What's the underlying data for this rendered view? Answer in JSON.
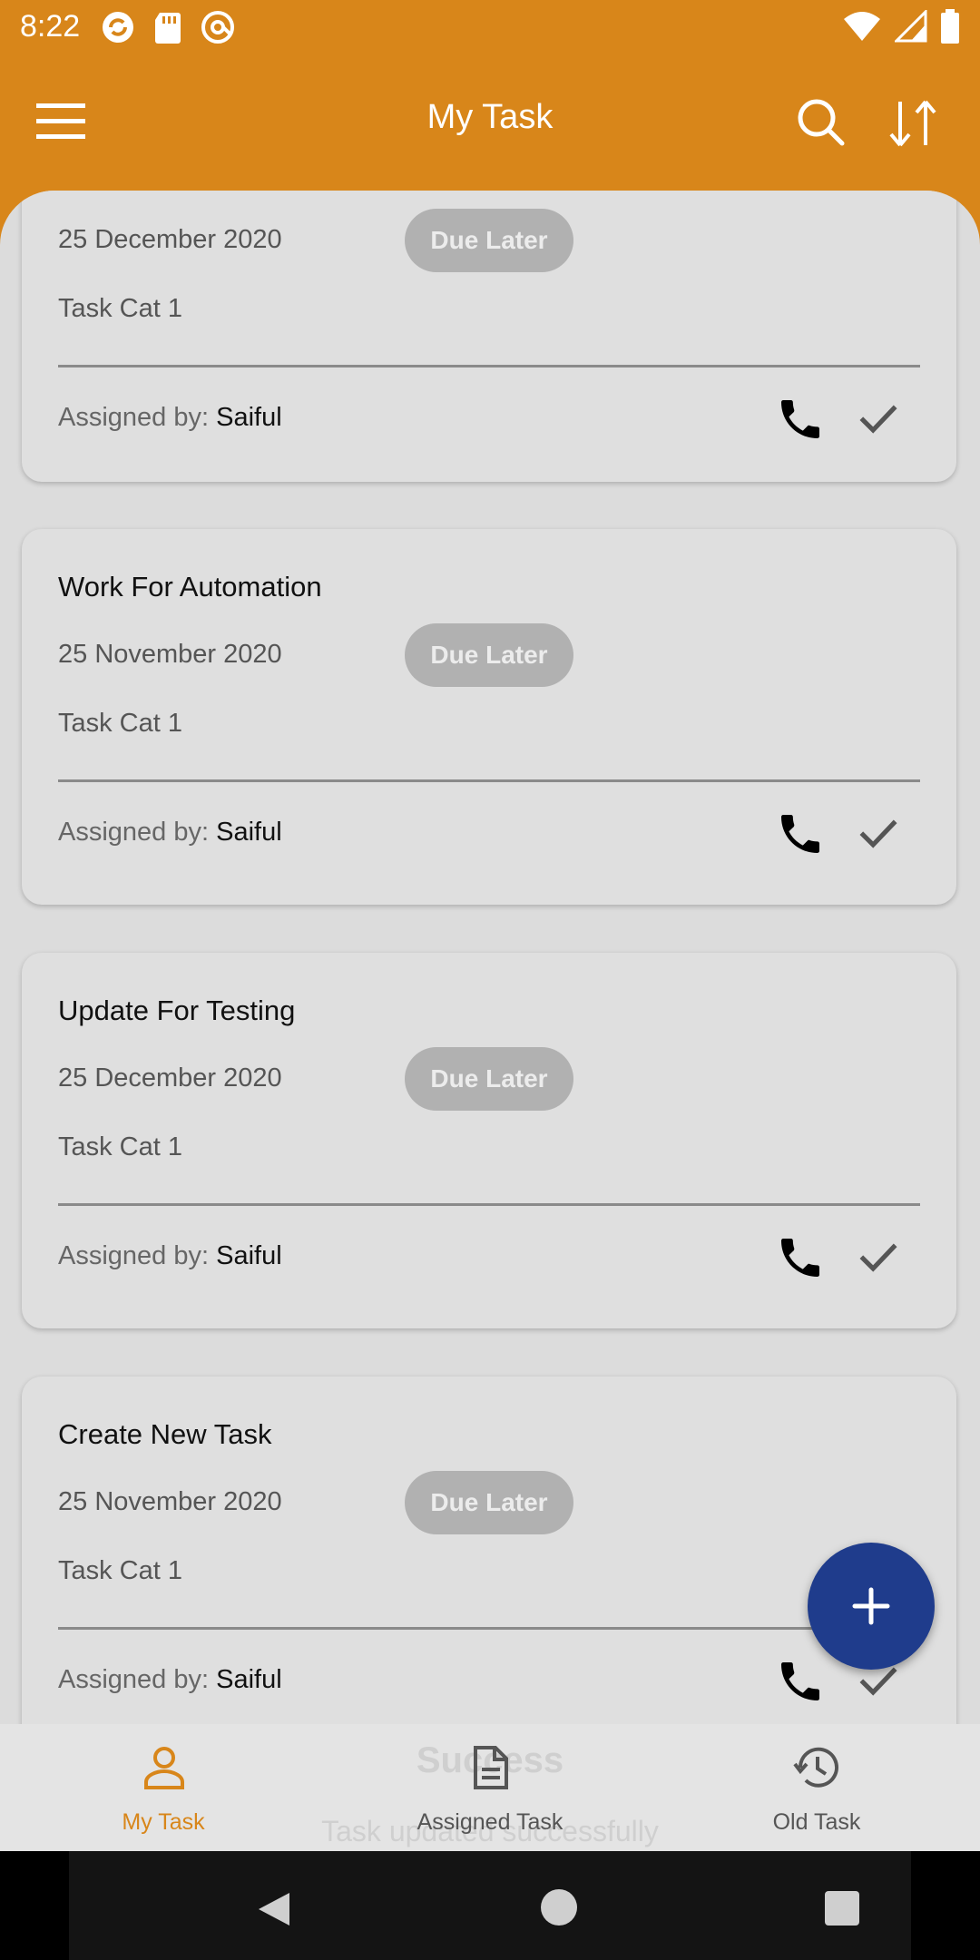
{
  "status_bar": {
    "time": "8:22"
  },
  "app_bar": {
    "title": "My Task"
  },
  "colors": {
    "accent": "#d8861a",
    "fab": "#1f3c8c",
    "badge": "#b1b1b1"
  },
  "tasks": [
    {
      "title": "",
      "date": "25 December 2020",
      "badge": "Due Later",
      "category": "Task Cat 1",
      "assigned_label": "Assigned by: ",
      "assigned_by": "Saiful"
    },
    {
      "title": "Work For Automation",
      "date": "25 November 2020",
      "badge": "Due Later",
      "category": "Task Cat 1",
      "assigned_label": "Assigned by: ",
      "assigned_by": "Saiful"
    },
    {
      "title": "Update For Testing",
      "date": "25 December 2020",
      "badge": "Due Later",
      "category": "Task Cat 1",
      "assigned_label": "Assigned by: ",
      "assigned_by": "Saiful"
    },
    {
      "title": "Create New Task",
      "date": "25 November 2020",
      "badge": "Due Later",
      "category": "Task Cat 1",
      "assigned_label": "Assigned by: ",
      "assigned_by": "Saiful"
    }
  ],
  "bottom_nav": [
    {
      "label": "My Task",
      "icon": "person-icon"
    },
    {
      "label": "Assigned Task",
      "icon": "document-icon"
    },
    {
      "label": "Old Task",
      "icon": "history-icon"
    }
  ],
  "toast": {
    "title": "Success",
    "message": "Task updated successfully"
  }
}
